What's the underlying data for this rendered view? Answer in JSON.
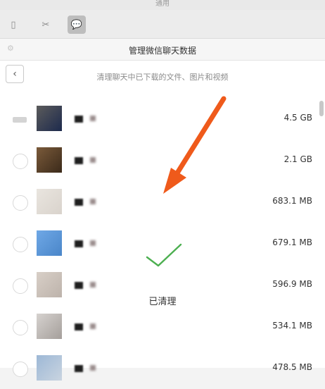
{
  "window": {
    "title": "通用"
  },
  "panel": {
    "title": "管理微信聊天数据",
    "subtitle": "清理聊天中已下载的文件、图片和视频",
    "done_label": "已清理"
  },
  "toolbar": {
    "icons": [
      "phone-icon",
      "scissors-icon",
      "chat-icon"
    ]
  },
  "rows": [
    {
      "size": "4.5 GB",
      "state": "partial",
      "avatar_colors": [
        "#5b5b5b",
        "#1d2a4d"
      ]
    },
    {
      "size": "2.1 GB",
      "state": "off",
      "avatar_colors": [
        "#7a5a3a",
        "#3b2a1a"
      ]
    },
    {
      "size": "683.1 MB",
      "state": "off",
      "avatar_colors": [
        "#e9e5df",
        "#d9d3cc"
      ]
    },
    {
      "size": "679.1 MB",
      "state": "off",
      "avatar_colors": [
        "#6fa8e6",
        "#4a86c9"
      ]
    },
    {
      "size": "596.9 MB",
      "state": "off",
      "avatar_colors": [
        "#d8cfc7",
        "#bdb3ab"
      ]
    },
    {
      "size": "534.1 MB",
      "state": "off",
      "avatar_colors": [
        "#d6d2cf",
        "#a59f9b"
      ]
    },
    {
      "size": "478.5 MB",
      "state": "off",
      "avatar_colors": [
        "#9db8d6",
        "#c9d4e0"
      ]
    }
  ],
  "colors": {
    "arrow": "#ef5a1b",
    "check": "#4caf50"
  }
}
